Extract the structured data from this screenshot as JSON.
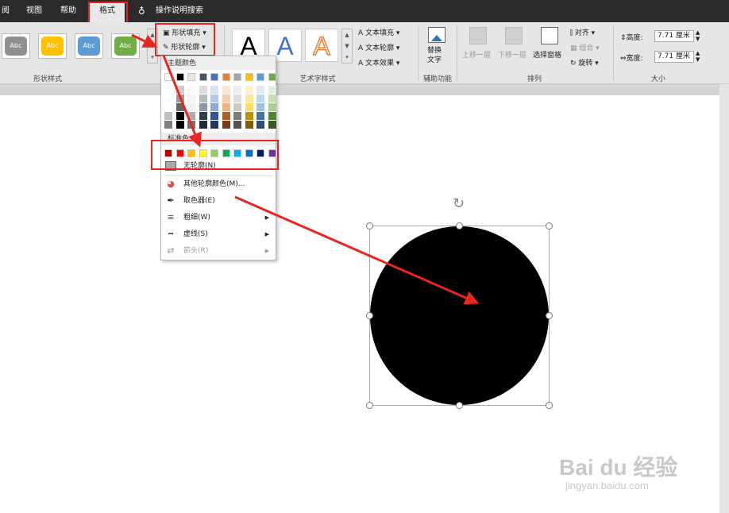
{
  "tabs": [
    "阅",
    "视图",
    "帮助",
    "格式"
  ],
  "tell_me": "操作说明搜索",
  "shape_styles": {
    "label": "形状样式",
    "items": [
      {
        "text": "Abc",
        "color": "#909090"
      },
      {
        "text": "Abc",
        "color": "#ffc000"
      },
      {
        "text": "Abc",
        "color": "#5b9bd5"
      },
      {
        "text": "Abc",
        "color": "#70ad47"
      }
    ],
    "fill": "形状填充",
    "outline": "形状轮廓"
  },
  "wordart": {
    "label": "艺术字样式",
    "letters": [
      "A",
      "A",
      "A"
    ],
    "text_fill": "文本填充",
    "text_outline": "文本轮廓",
    "text_effect": "文本效果"
  },
  "accessibility": {
    "label": "辅助功能",
    "alt_text": "替换\n文字"
  },
  "arrange": {
    "label": "排列",
    "bring_forward": "上移一层",
    "send_backward": "下移一层",
    "selection_pane": "选择窗格",
    "align": "对齐",
    "group": "组合",
    "rotate": "旋转"
  },
  "size": {
    "label": "大小",
    "height_label": "高度:",
    "height": "7.71 厘米",
    "width_label": "宽度:",
    "width": "7.71 厘米"
  },
  "dropdown": {
    "theme_colors": "主题颜色",
    "standard_colors": "标准色",
    "no_outline": "无轮廓(N)",
    "more_colors": "其他轮廓颜色(M)...",
    "eyedropper": "取色器(E)",
    "weight": "粗细(W)",
    "dashes": "虚线(S)",
    "arrows": "箭头(R)",
    "theme_top": [
      "#ffffff",
      "#000000",
      "#e7e6e6",
      "#44546a",
      "#4472c4",
      "#ed7d31",
      "#a5a5a5",
      "#ffc000",
      "#5b9bd5",
      "#70ad47"
    ],
    "standard": [
      "#c00000",
      "#ff0000",
      "#ffc000",
      "#ffff00",
      "#92d050",
      "#00b050",
      "#00b0f0",
      "#0070c0",
      "#002060",
      "#7030a0"
    ]
  },
  "watermark": {
    "logo": "Bai du 经验",
    "url": "jingyan.baidu.com"
  },
  "colors": {
    "highlight": "#e8261f",
    "shape_fill": "#000000"
  }
}
